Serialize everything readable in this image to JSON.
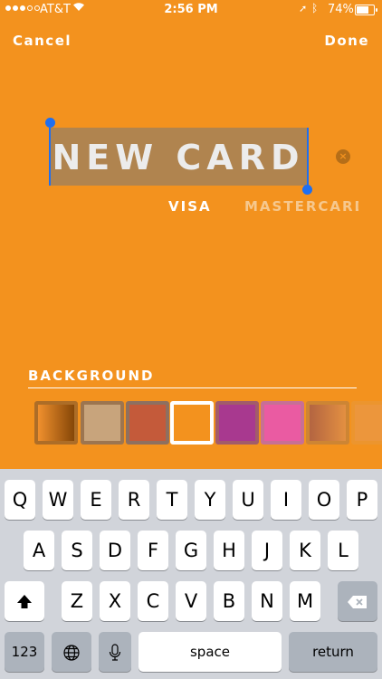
{
  "status": {
    "carrier": "AT&T",
    "time": "2:56 PM",
    "battery": "74%",
    "battery_level": 74
  },
  "nav": {
    "cancel": "Cancel",
    "done": "Done"
  },
  "card": {
    "title": "NEW CARD",
    "brands": [
      "VISA",
      "MASTERCARD"
    ]
  },
  "background": {
    "label": "BACKGROUND",
    "swatches": [
      {
        "color": "#a65a12",
        "selected": false
      },
      {
        "color": "#c4a07a",
        "selected": false
      },
      {
        "color": "#c45a3a",
        "selected": false
      },
      {
        "color": "#f3921e",
        "selected": true
      },
      {
        "color": "#a8398f",
        "selected": false
      },
      {
        "color": "#ea5ba2",
        "selected": false
      },
      {
        "color": "#b87050",
        "selected": false
      },
      {
        "color": "#e89a50",
        "selected": false
      }
    ]
  },
  "keyboard": {
    "row1": [
      "Q",
      "W",
      "E",
      "R",
      "T",
      "Y",
      "U",
      "I",
      "O",
      "P"
    ],
    "row2": [
      "A",
      "S",
      "D",
      "F",
      "G",
      "H",
      "J",
      "K",
      "L"
    ],
    "row3": [
      "Z",
      "X",
      "C",
      "V",
      "B",
      "N",
      "M"
    ],
    "numbers_key": "123",
    "space_key": "space",
    "return_key": "return",
    "icons": [
      "shift-icon",
      "backspace-icon",
      "globe-icon",
      "microphone-icon"
    ]
  },
  "colors": {
    "accent": "#f3921e",
    "selection": "#1f6ff0",
    "keyboard_bg": "#d1d4da"
  }
}
